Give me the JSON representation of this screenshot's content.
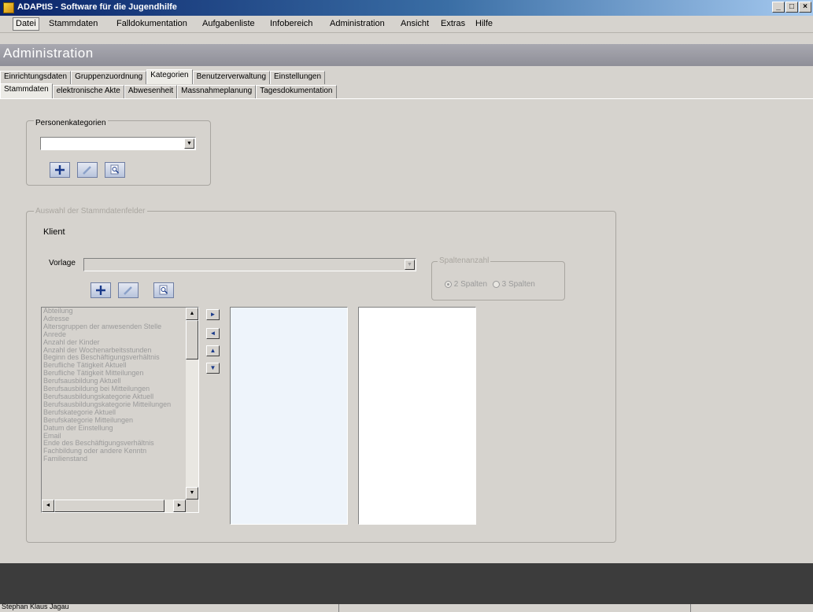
{
  "window": {
    "title": "ADAPtIS - Software für die Jugendhilfe",
    "buttons": [
      "_",
      "□",
      "×"
    ]
  },
  "menu": [
    "Datei",
    "Stammdaten",
    "Falldokumentation",
    "Aufgabenliste",
    "Infobereich",
    "Administration",
    "Ansicht",
    "Extras",
    "Hilfe"
  ],
  "header": {
    "title": "Administration"
  },
  "tabs_top": [
    "Einrichtungsdaten",
    "Gruppenzuordnung",
    "Kategorien",
    "Benutzerverwaltung",
    "Einstellungen"
  ],
  "tabs_sub": [
    "Stammdaten",
    "elektronische Akte",
    "Abwesenheit",
    "Massnahmeplanung",
    "Tagesdokumentation"
  ],
  "person_categories": {
    "label": "Personenkategorien",
    "value": ""
  },
  "selection_group": {
    "label": "Auswahl der Stammdatenfelder",
    "person_type": "Klient",
    "template_label": "Vorlage",
    "template_value": "",
    "columns_group": {
      "label": "Spaltenanzahl",
      "options": [
        "2 Spalten",
        "3 Spalten"
      ],
      "selected": 0
    },
    "attributes": [
      "Abteilung",
      "Adresse",
      "Altersgruppen der anwesenden Stelle",
      "Anrede",
      "Anzahl der Kinder",
      "Anzahl der Wochenarbeitsstunden",
      "Beginn des Beschäftigungsverhältnis",
      "Berufliche Tätigkeit Aktuell",
      "Berufliche Tätigkeit Mitteilungen",
      "Berufsausbildung Aktuell",
      "Berufsausbildung bei Mitteilungen",
      "Berufsausbildungskategorie Aktuell",
      "Berufsausbildungskategorie Mitteilungen",
      "Berufskategorie Aktuell",
      "Berufskategorie Mitteilungen",
      "Datum der Einstellung",
      "Email",
      "Ende des Beschäftigungsverhältnis",
      "Fachbildung oder andere Kenntn",
      "Familienstand"
    ]
  },
  "statusbar": {
    "user": "Stephan Klaus Jagau"
  }
}
